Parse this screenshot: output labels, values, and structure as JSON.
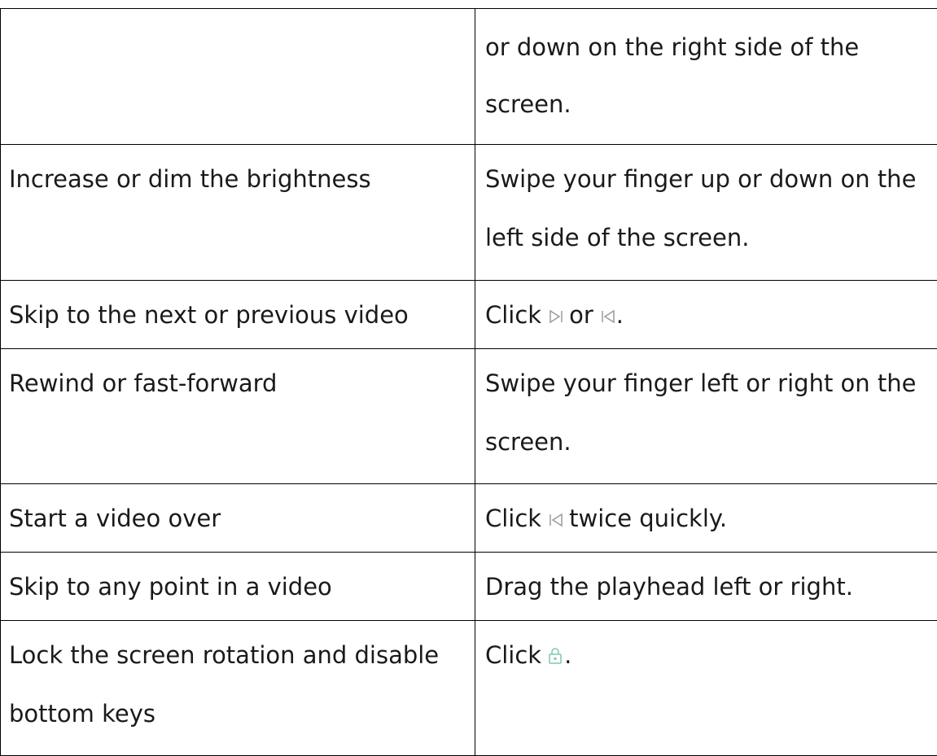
{
  "table": {
    "rows": [
      {
        "action": "",
        "method_lines": [
          "or down on the right side of the",
          "screen."
        ]
      },
      {
        "action": "Increase or dim the brightness",
        "method_lines": [
          "Swipe your finger up or down on the",
          "left side of the screen."
        ]
      },
      {
        "action": "Skip to the next or previous video",
        "method": {
          "prefix": "Click",
          "middle": "or",
          "suffix": "."
        },
        "icons": [
          "next-video-icon",
          "previous-video-icon"
        ]
      },
      {
        "action": "Rewind or fast-forward",
        "method_lines": [
          "Swipe your finger left or right on the",
          "screen."
        ]
      },
      {
        "action": "Start a video over",
        "method": {
          "prefix": "Click",
          "suffix": "twice quickly."
        },
        "icons": [
          "previous-video-icon"
        ]
      },
      {
        "action": "Skip to any point in a video",
        "method_text": "Drag the playhead left or right."
      },
      {
        "action_lines": [
          "Lock the screen rotation and disable",
          "bottom keys"
        ],
        "method": {
          "prefix": "Click",
          "suffix": "."
        },
        "icons": [
          "lock-icon"
        ]
      }
    ]
  },
  "colors": {
    "border": "#000000",
    "text": "#1a1a1a",
    "icon_gray": "#9a9a9a",
    "icon_green": "#7fc9a8"
  }
}
